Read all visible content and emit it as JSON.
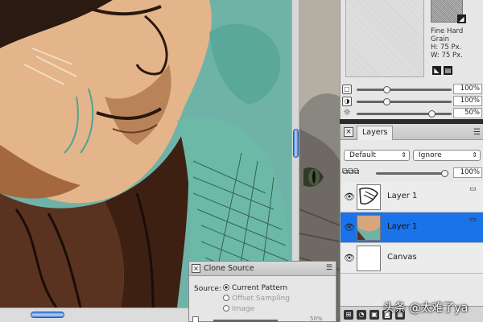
{
  "texture_panel": {
    "grain_name": "Fine Hard Grain",
    "height_label": "H: 75 Px.",
    "width_label": "W: 75 Px.",
    "sliders": [
      {
        "icon": "layer-opacity-icon",
        "value_text": "100%",
        "level": 0.3
      },
      {
        "icon": "contrast-icon",
        "value_text": "100%",
        "level": 0.3
      },
      {
        "icon": "brightness-icon",
        "value_text": "50%",
        "level": 0.82
      }
    ]
  },
  "layers_panel": {
    "title": "Layers",
    "blend_mode": "Default",
    "composite": "Ignore",
    "opacity_text": "100%",
    "opacity_level": 1.0,
    "layers": [
      {
        "name": "Layer 1",
        "selected": false,
        "thumb": "sketch"
      },
      {
        "name": "Layer 1",
        "selected": true,
        "thumb": "color"
      },
      {
        "name": "Canvas",
        "selected": false,
        "thumb": "blank"
      }
    ]
  },
  "clone_source": {
    "title": "Clone Source",
    "source_label": "Source:",
    "options": [
      {
        "label": "Current Pattern",
        "checked": true,
        "enabled": true
      },
      {
        "label": "Offset Sampling",
        "checked": false,
        "enabled": false
      },
      {
        "label": "Image",
        "checked": false,
        "enabled": false
      }
    ],
    "partial_value": "50%"
  },
  "watermark": "头条 @太难了ya"
}
